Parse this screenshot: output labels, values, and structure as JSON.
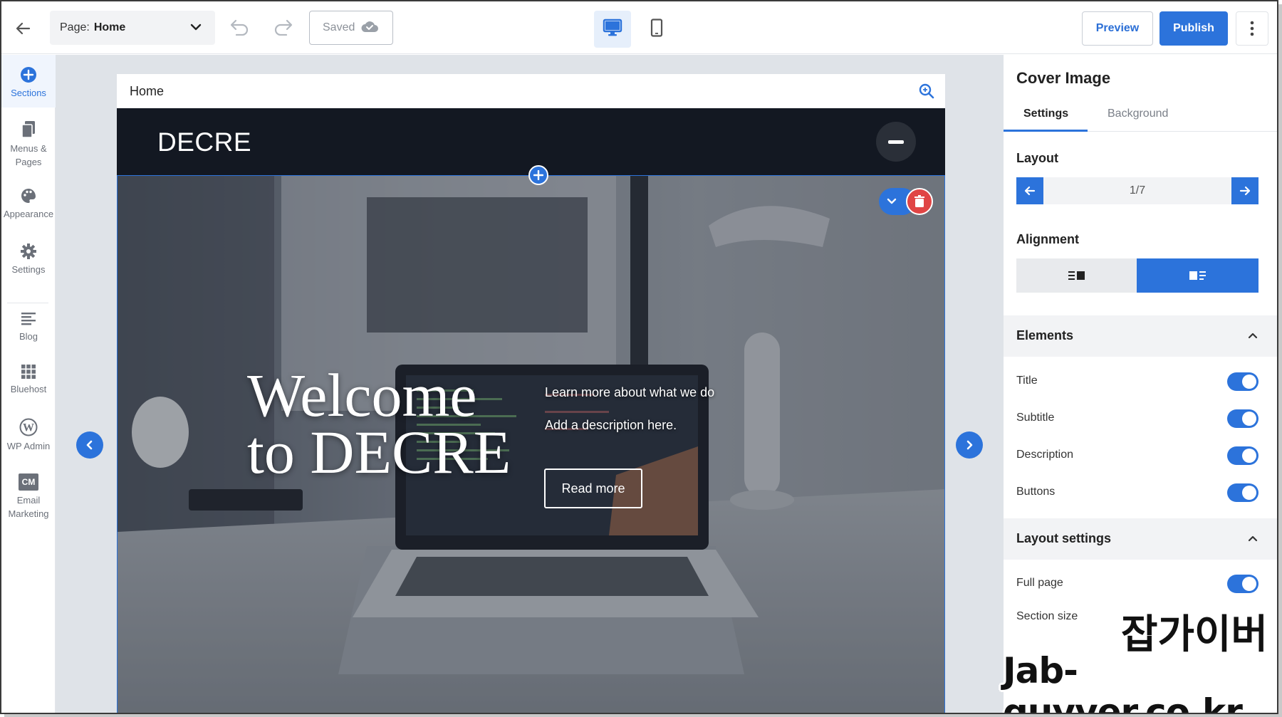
{
  "topbar": {
    "page_prefix": "Page:",
    "page_name": "Home",
    "saved_label": "Saved",
    "preview_label": "Preview",
    "publish_label": "Publish"
  },
  "rail": {
    "items": [
      {
        "label": "Sections",
        "icon": "plus-circle-icon",
        "active": true
      },
      {
        "label": "Menus &",
        "label2": "Pages",
        "icon": "pages-icon"
      },
      {
        "label": "Appearance",
        "icon": "palette-icon"
      },
      {
        "label": "Settings",
        "icon": "gear-icon"
      },
      {
        "label": "Blog",
        "icon": "blog-icon"
      },
      {
        "label": "Bluehost",
        "icon": "grid-icon"
      },
      {
        "label": "WP Admin",
        "icon": "wordpress-icon"
      },
      {
        "label": "Email",
        "label2": "Marketing",
        "icon": "cm-icon",
        "icon_text": "CM"
      }
    ]
  },
  "site": {
    "breadcrumb": "Home",
    "brand": "DECRE",
    "hero_title_line1": "Welcome",
    "hero_title_line2": "to DECRE",
    "hero_subtitle": "Learn more about what we do",
    "hero_description": "Add a description here.",
    "hero_button": "Read more"
  },
  "panel": {
    "title": "Cover Image",
    "tabs": [
      "Settings",
      "Background"
    ],
    "layout_label": "Layout",
    "layout_value": "1/7",
    "alignment_label": "Alignment",
    "elements_label": "Elements",
    "elements": [
      {
        "label": "Title",
        "on": true
      },
      {
        "label": "Subtitle",
        "on": true
      },
      {
        "label": "Description",
        "on": true
      },
      {
        "label": "Buttons",
        "on": true
      }
    ],
    "layout_settings_label": "Layout settings",
    "full_page_label": "Full page",
    "section_size_label": "Section size"
  },
  "watermark": {
    "line1": "잡가이버",
    "line2": "Jab-guyver.co.kr"
  },
  "colors": {
    "accent": "#2c73db",
    "delete": "#e04545",
    "header_dark": "#131822"
  }
}
